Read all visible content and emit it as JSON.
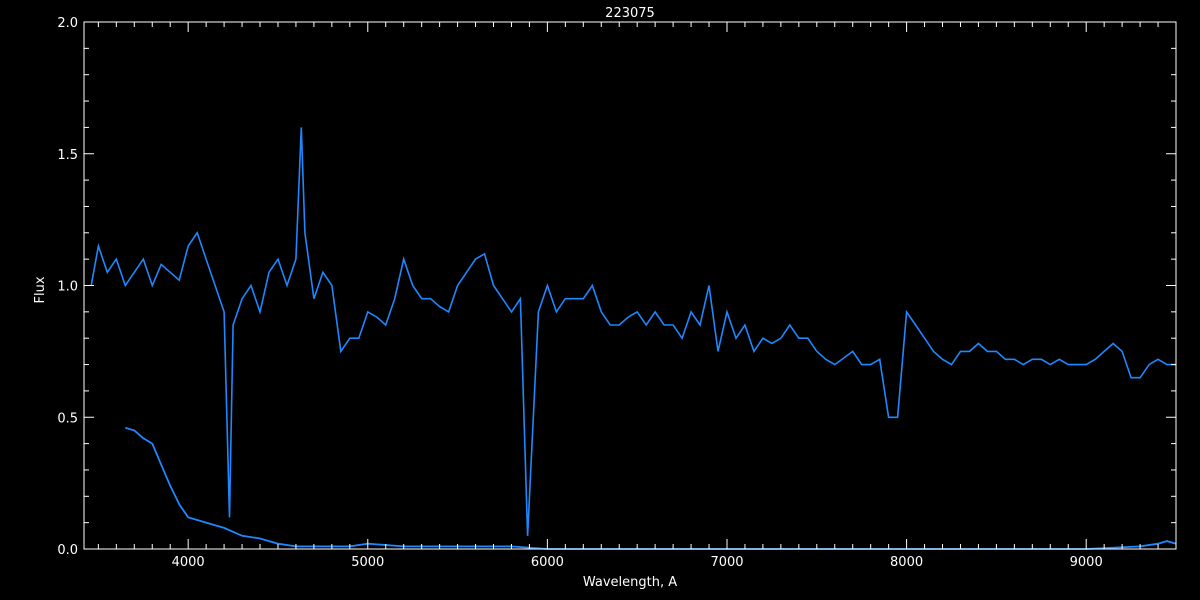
{
  "chart_data": {
    "type": "line",
    "title": "223075",
    "xlabel": "Wavelength, A",
    "ylabel": "Flux",
    "xlim": [
      3420,
      9500
    ],
    "ylim": [
      0.0,
      2.0
    ],
    "x_ticks": [
      4000,
      5000,
      6000,
      7000,
      8000,
      9000
    ],
    "y_ticks": [
      0.0,
      0.5,
      1.0,
      1.5,
      2.0
    ],
    "y_tick_labels": [
      "0.0",
      "0.5",
      "1.0",
      "1.5",
      "2.0"
    ],
    "grid": false,
    "background": "#000000",
    "axis_color": "#ffffff",
    "series": [
      {
        "color": "#1e88ff",
        "x": [
          3460,
          3500,
          3550,
          3600,
          3650,
          3700,
          3750,
          3800,
          3850,
          3900,
          3950,
          4000,
          4050,
          4100,
          4150,
          4200,
          4230,
          4250,
          4300,
          4350,
          4400,
          4450,
          4500,
          4550,
          4600,
          4630,
          4650,
          4700,
          4750,
          4800,
          4850,
          4900,
          4950,
          5000,
          5050,
          5100,
          5150,
          5200,
          5250,
          5300,
          5350,
          5400,
          5450,
          5500,
          5550,
          5600,
          5650,
          5700,
          5750,
          5800,
          5850,
          5890,
          5950,
          6000,
          6050,
          6100,
          6150,
          6200,
          6250,
          6300,
          6350,
          6400,
          6450,
          6500,
          6550,
          6600,
          6650,
          6700,
          6750,
          6800,
          6850,
          6900,
          6950,
          7000,
          7050,
          7100,
          7150,
          7200,
          7250,
          7300,
          7350,
          7400,
          7450,
          7500,
          7550,
          7600,
          7700,
          7750,
          7800,
          7850,
          7900,
          7950,
          8000,
          8050,
          8100,
          8150,
          8200,
          8250,
          8300,
          8350,
          8400,
          8450,
          8500,
          8550,
          8600,
          8650,
          8700,
          8750,
          8800,
          8850,
          8900,
          8950,
          9000,
          9050,
          9100,
          9150,
          9200,
          9250,
          9300,
          9350,
          9400,
          9450,
          9500
        ],
        "y": [
          1.0,
          1.15,
          1.05,
          1.1,
          1.0,
          1.05,
          1.1,
          1.0,
          1.08,
          1.05,
          1.02,
          1.15,
          1.2,
          1.1,
          1.0,
          0.9,
          0.12,
          0.85,
          0.95,
          1.0,
          0.9,
          1.05,
          1.1,
          1.0,
          1.1,
          1.6,
          1.2,
          0.95,
          1.05,
          1.0,
          0.75,
          0.8,
          0.8,
          0.9,
          0.88,
          0.85,
          0.95,
          1.1,
          1.0,
          0.95,
          0.95,
          0.92,
          0.9,
          1.0,
          1.05,
          1.1,
          1.12,
          1.0,
          0.95,
          0.9,
          0.95,
          0.05,
          0.9,
          1.0,
          0.9,
          0.95,
          0.95,
          0.95,
          1.0,
          0.9,
          0.85,
          0.85,
          0.88,
          0.9,
          0.85,
          0.9,
          0.85,
          0.85,
          0.8,
          0.9,
          0.85,
          1.0,
          0.75,
          0.9,
          0.8,
          0.85,
          0.75,
          0.8,
          0.78,
          0.8,
          0.85,
          0.8,
          0.8,
          0.75,
          0.72,
          0.7,
          0.75,
          0.7,
          0.7,
          0.72,
          0.5,
          0.5,
          0.9,
          0.85,
          0.8,
          0.75,
          0.72,
          0.7,
          0.75,
          0.75,
          0.78,
          0.75,
          0.75,
          0.72,
          0.72,
          0.7,
          0.72,
          0.72,
          0.7,
          0.72,
          0.7,
          0.7,
          0.7,
          0.72,
          0.75,
          0.78,
          0.75,
          0.65,
          0.65,
          0.7,
          0.72,
          0.7,
          0.7
        ]
      },
      {
        "color": "#1e88ff",
        "x": [
          3650,
          3700,
          3750,
          3800,
          3850,
          3900,
          3950,
          4000,
          4100,
          4200,
          4300,
          4400,
          4500,
          4600,
          4700,
          4800,
          4900,
          5000,
          5200,
          5400,
          5600,
          5800,
          6000,
          6500,
          7000,
          7500,
          8000,
          8500,
          9000,
          9300,
          9400,
          9450,
          9500
        ],
        "y": [
          0.46,
          0.45,
          0.42,
          0.4,
          0.32,
          0.24,
          0.17,
          0.12,
          0.1,
          0.08,
          0.05,
          0.04,
          0.02,
          0.01,
          0.01,
          0.01,
          0.01,
          0.02,
          0.01,
          0.01,
          0.01,
          0.01,
          0.0,
          0.0,
          0.0,
          0.0,
          0.0,
          0.0,
          0.0,
          0.01,
          0.02,
          0.03,
          0.02
        ]
      }
    ]
  }
}
